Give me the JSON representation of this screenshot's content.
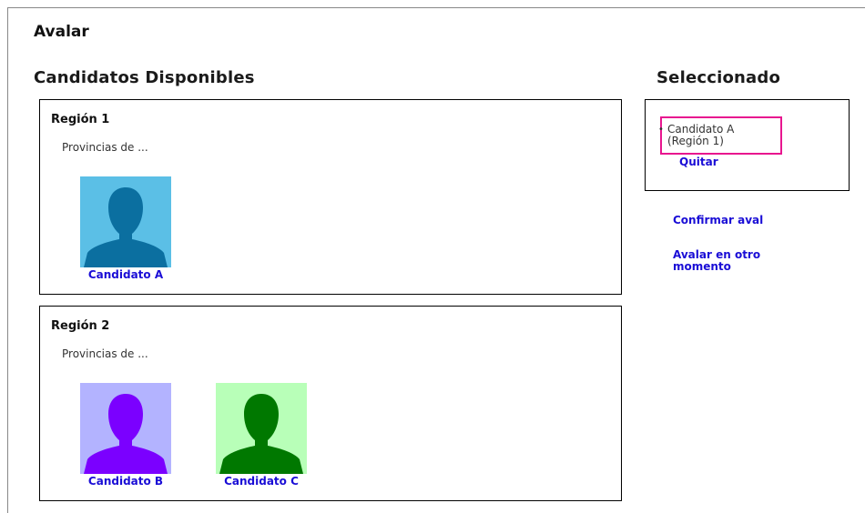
{
  "page": {
    "title": "Avalar"
  },
  "available": {
    "title": "Candidatos Disponibles",
    "regions": [
      {
        "name": "Región 1",
        "description": "Provincias de ...",
        "candidates": [
          {
            "name": "Candidato A",
            "bg_color": "#5bbfe6",
            "fg_color": "#0b6fa0"
          }
        ]
      },
      {
        "name": "Región 2",
        "description": "Provincias de ...",
        "candidates": [
          {
            "name": "Candidato B",
            "bg_color": "#b3b3ff",
            "fg_color": "#7b00ff"
          },
          {
            "name": "Candidato C",
            "bg_color": "#b8ffb8",
            "fg_color": "#007800"
          }
        ]
      }
    ]
  },
  "selected": {
    "title": "Seleccionado",
    "items": [
      {
        "label": "Candidato A (Región 1)",
        "remove_label": "Quitar"
      }
    ],
    "highlight_color": "#e8168f"
  },
  "actions": {
    "confirm_label": "Confirmar aval",
    "later_label": "Avalar en otro momento"
  },
  "colors": {
    "link": "#1a0dd6"
  },
  "icons": {
    "candidate_photo": "person-silhouette-icon",
    "bullet": "bullet-icon"
  }
}
